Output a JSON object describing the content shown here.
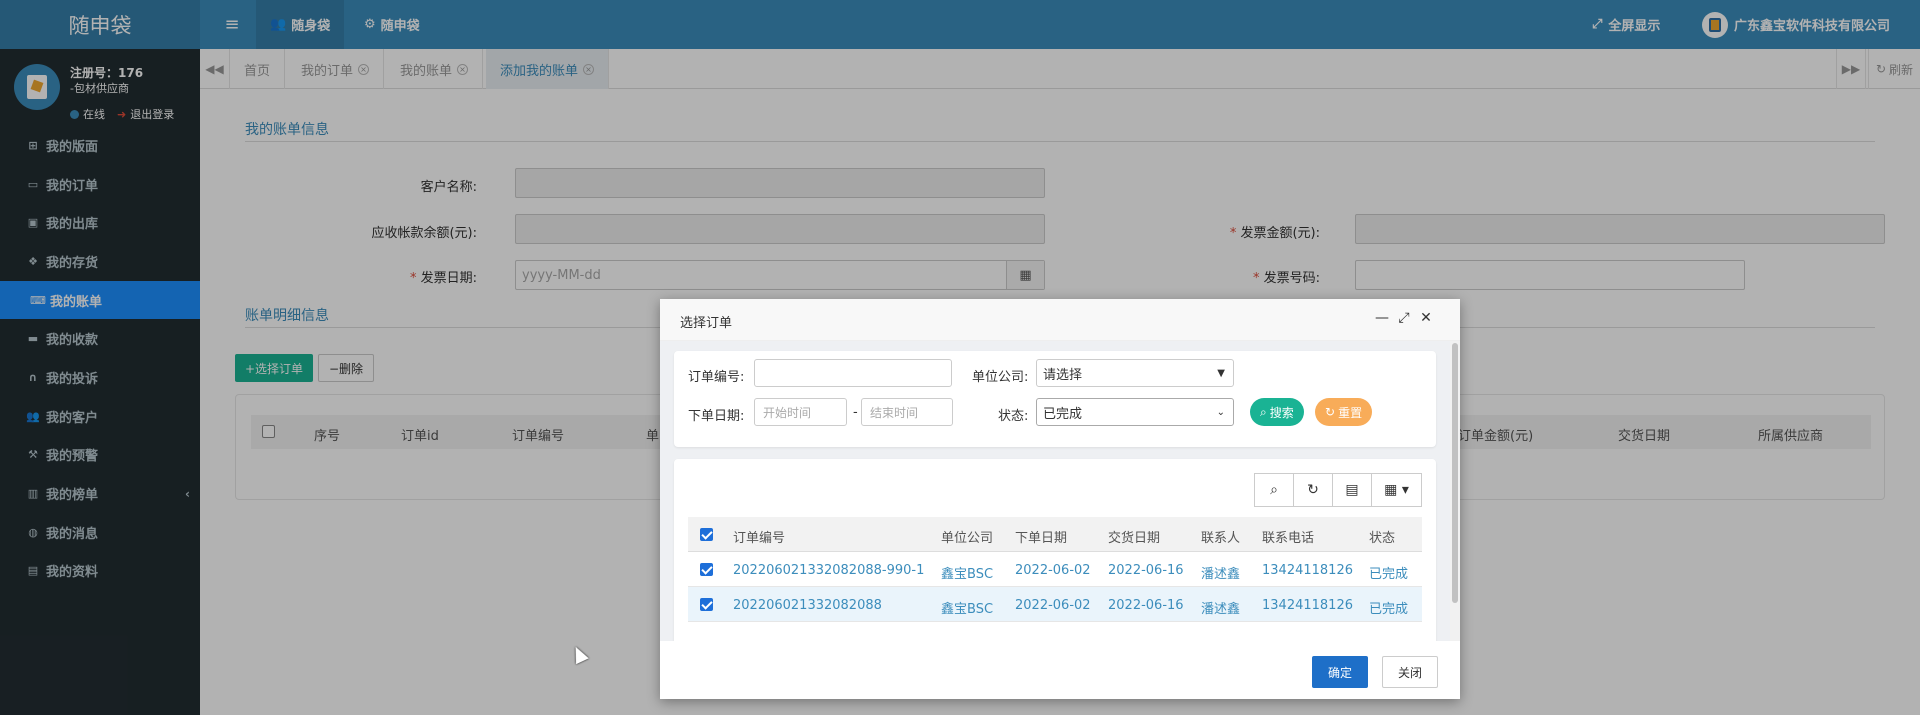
{
  "header": {
    "logo": "随申袋",
    "menu_icon": "bars-icon",
    "tabs": [
      {
        "label": "随身袋",
        "icon": "users-icon"
      },
      {
        "label": "随申袋",
        "icon": "gear-icon"
      }
    ],
    "fullscreen_label": "全屏显示",
    "company_name": "广东鑫宝软件科技有限公司"
  },
  "sidebar": {
    "user_reg": "注册号：176",
    "user_role": "-包材供应商",
    "status_online": "在线",
    "logout": "退出登录",
    "items": [
      {
        "label": "我的版面",
        "icon": "sitemap-icon"
      },
      {
        "label": "我的订单",
        "icon": "monitor-icon"
      },
      {
        "label": "我的出库",
        "icon": "bus-icon"
      },
      {
        "label": "我的存货",
        "icon": "cubes-icon"
      },
      {
        "label": "我的账单",
        "icon": "keyboard-icon",
        "active": true
      },
      {
        "label": "我的收款",
        "icon": "credit-card-icon"
      },
      {
        "label": "我的投诉",
        "icon": "headset-icon"
      },
      {
        "label": "我的客户",
        "icon": "users-icon"
      },
      {
        "label": "我的预警",
        "icon": "gavel-icon"
      },
      {
        "label": "我的榜单",
        "icon": "bar-chart-icon"
      },
      {
        "label": "我的消息",
        "icon": "globe-icon"
      },
      {
        "label": "我的资料",
        "icon": "id-card-icon"
      }
    ]
  },
  "page_tabs": {
    "items": [
      {
        "label": "首页",
        "closable": false
      },
      {
        "label": "我的订单",
        "closable": true
      },
      {
        "label": "我的账单",
        "closable": true
      },
      {
        "label": "添加我的账单",
        "closable": true,
        "active": true
      }
    ],
    "refresh_label": "刷新"
  },
  "form": {
    "section1_title": "我的账单信息",
    "customer_label": "客户名称:",
    "receivable_label": "应收帐款余额(元):",
    "invoice_amount_label": "发票金额(元):",
    "invoice_date_label": "发票日期:",
    "invoice_date_placeholder": "yyyy-MM-dd",
    "invoice_no_label": "发票号码:",
    "required_mark": "*",
    "section2_title": "账单明细信息",
    "select_order_btn": "+选择订单",
    "delete_btn": "−删除",
    "table_headers": [
      "序号",
      "订单id",
      "订单编号",
      "单",
      "订单金额(元)",
      "交货日期",
      "所属供应商"
    ]
  },
  "modal": {
    "title": "选择订单",
    "search": {
      "order_no_label": "订单编号:",
      "company_label": "单位公司:",
      "company_value": "请选择",
      "date_label": "下单日期:",
      "start_placeholder": "开始时间",
      "date_separator": "-",
      "end_placeholder": "结束时间",
      "status_label": "状态:",
      "status_value": "已完成",
      "search_btn": "搜索",
      "reset_btn": "重置"
    },
    "table": {
      "headers": [
        "订单编号",
        "单位公司",
        "下单日期",
        "交货日期",
        "联系人",
        "联系电话",
        "状态"
      ],
      "rows": [
        {
          "order_no": "202206021332082088-990-1",
          "company": "鑫宝BSC",
          "order_date": "2022-06-02",
          "delivery_date": "2022-06-16",
          "contact": "潘述鑫",
          "phone": "13424118126",
          "status": "已完成",
          "checked": true
        },
        {
          "order_no": "202206021332082088",
          "company": "鑫宝BSC",
          "order_date": "2022-06-02",
          "delivery_date": "2022-06-16",
          "contact": "潘述鑫",
          "phone": "13424118126",
          "status": "已完成",
          "checked": true
        }
      ]
    },
    "ok_btn": "确定",
    "close_btn": "关闭"
  },
  "colors": {
    "header": "#3c8dbc",
    "sidebar": "#222d32",
    "active_menu": "#1e90ff",
    "search_btn": "#1ab394",
    "reset_btn": "#f8ac59",
    "ok_btn": "#1e6fc8"
  }
}
